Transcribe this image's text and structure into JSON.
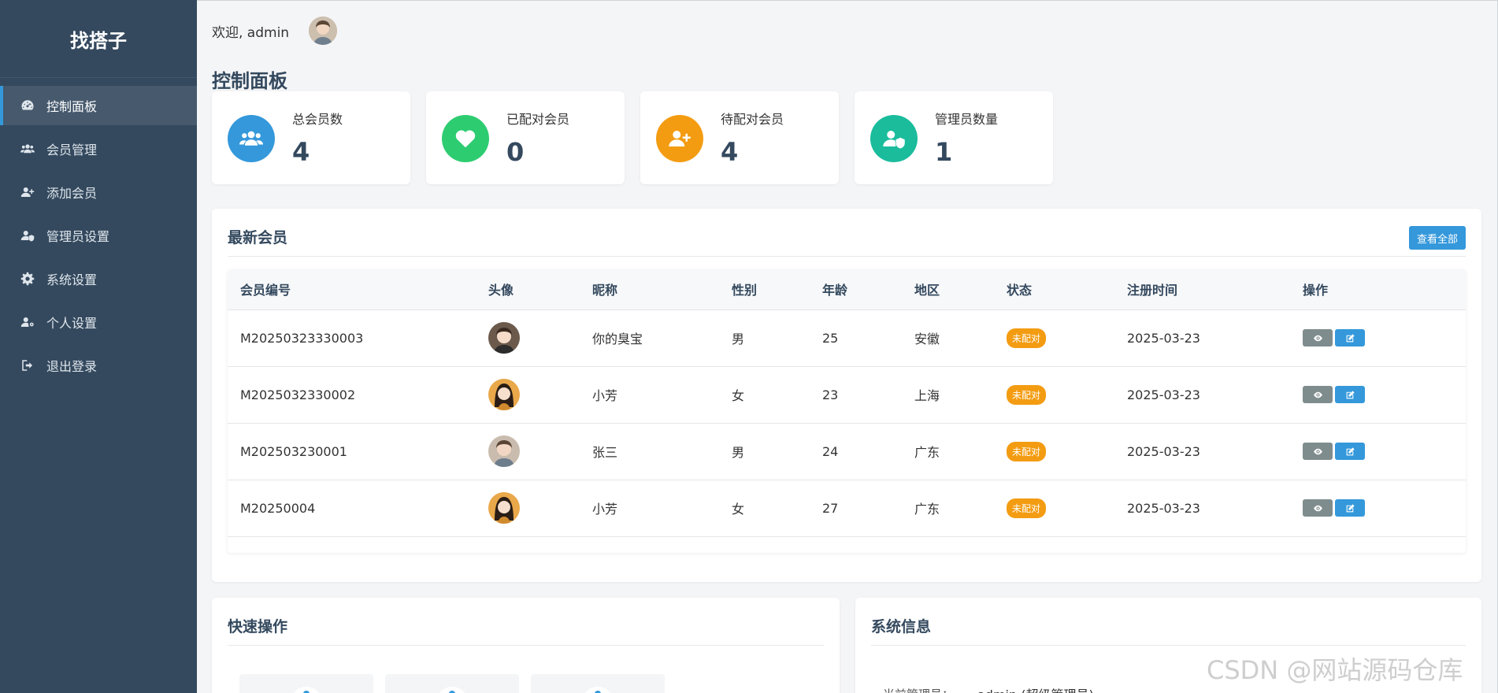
{
  "brand": "找搭子",
  "sidebar": {
    "items": [
      {
        "label": "控制面板",
        "icon": "tachometer-icon"
      },
      {
        "label": "会员管理",
        "icon": "users-icon"
      },
      {
        "label": "添加会员",
        "icon": "user-plus-icon"
      },
      {
        "label": "管理员设置",
        "icon": "user-shield-icon"
      },
      {
        "label": "系统设置",
        "icon": "gear-icon"
      },
      {
        "label": "个人设置",
        "icon": "user-gear-icon"
      },
      {
        "label": "退出登录",
        "icon": "sign-out-icon"
      }
    ]
  },
  "header": {
    "welcome": "欢迎, admin"
  },
  "page": {
    "title": "控制面板"
  },
  "stats": [
    {
      "label": "总会员数",
      "value": "4",
      "color": "#3498db",
      "icon": "users-icon"
    },
    {
      "label": "已配对会员",
      "value": "0",
      "color": "#2ecc71",
      "icon": "heart-icon"
    },
    {
      "label": "待配对会员",
      "value": "4",
      "color": "#f39c12",
      "icon": "user-plus-icon"
    },
    {
      "label": "管理员数量",
      "value": "1",
      "color": "#1abc9c",
      "icon": "user-shield-icon"
    }
  ],
  "members": {
    "title": "最新会员",
    "view_all": "查看全部",
    "columns": [
      "会员编号",
      "头像",
      "昵称",
      "性别",
      "年龄",
      "地区",
      "状态",
      "注册时间",
      "操作"
    ],
    "rows": [
      {
        "id": "M20250323330003",
        "nickname": "你的臭宝",
        "gender": "男",
        "age": "25",
        "region": "安徽",
        "status": "未配对",
        "date": "2025-03-23"
      },
      {
        "id": "M2025032330002",
        "nickname": "小芳",
        "gender": "女",
        "age": "23",
        "region": "上海",
        "status": "未配对",
        "date": "2025-03-23"
      },
      {
        "id": "M202503230001",
        "nickname": "张三",
        "gender": "男",
        "age": "24",
        "region": "广东",
        "status": "未配对",
        "date": "2025-03-23"
      },
      {
        "id": "M20250004",
        "nickname": "小芳",
        "gender": "女",
        "age": "27",
        "region": "广东",
        "status": "未配对",
        "date": "2025-03-23"
      }
    ]
  },
  "quick_actions": {
    "title": "快速操作"
  },
  "system_info": {
    "title": "系统信息",
    "admin_label": "当前管理员：",
    "admin_value": "admin (超级管理员)"
  },
  "watermark": "CSDN @网站源码仓库"
}
